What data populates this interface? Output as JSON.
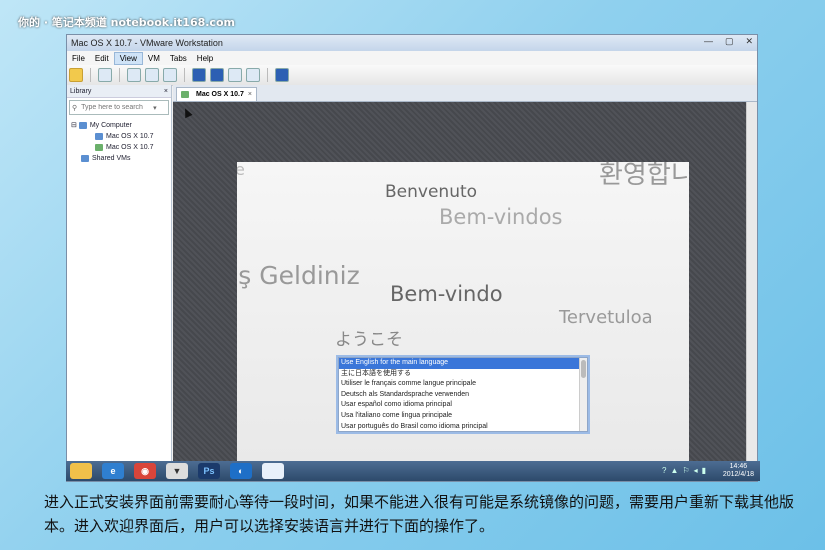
{
  "watermark": "你的 · 笔记本频道 notebook.it168.com",
  "window": {
    "title": "Mac OS X 10.7 - VMware Workstation",
    "controls": [
      "—",
      "▢",
      "✕"
    ]
  },
  "menu": [
    "File",
    "Edit",
    "View",
    "VM",
    "Tabs",
    "Help"
  ],
  "library": {
    "title": "Library",
    "close": "×",
    "search_placeholder": "Type here to search",
    "tree": {
      "root": "My Computer",
      "vm1": "Mac OS X 10.7",
      "vm2": "Mac OS X 10.7",
      "shared": "Shared VMs"
    }
  },
  "tab": {
    "label": "Mac OS X 10.7",
    "close": "×"
  },
  "welcome_words": {
    "fragment": "e",
    "korean": "환영합니",
    "benvenuto": "Benvenuto",
    "bemvindos": "Bem-vindos",
    "turkish": "oş Geldiniz",
    "bemvindo": "Bem-vindo",
    "finnish": "Tervetuloa",
    "japanese": "ようこそ"
  },
  "languages": [
    "Use English for the main language",
    "主に日本語を使用する",
    "Utiliser le français comme langue principale",
    "Deutsch als Standardsprache verwenden",
    "Usar español como idioma principal",
    "Usa l'italiano come lingua principale",
    "Usar português do Brasil como idioma principal"
  ],
  "taskbar": {
    "ps": "Ps",
    "time": "14:46",
    "date": "2012/4/18"
  },
  "caption": "进入正式安装界面前需要耐心等待一段时间，如果不能进入很有可能是系统镜像的问题，需要用户重新下载其他版本。进入欢迎界面后，用户可以选择安装语言并进行下面的操作了。"
}
